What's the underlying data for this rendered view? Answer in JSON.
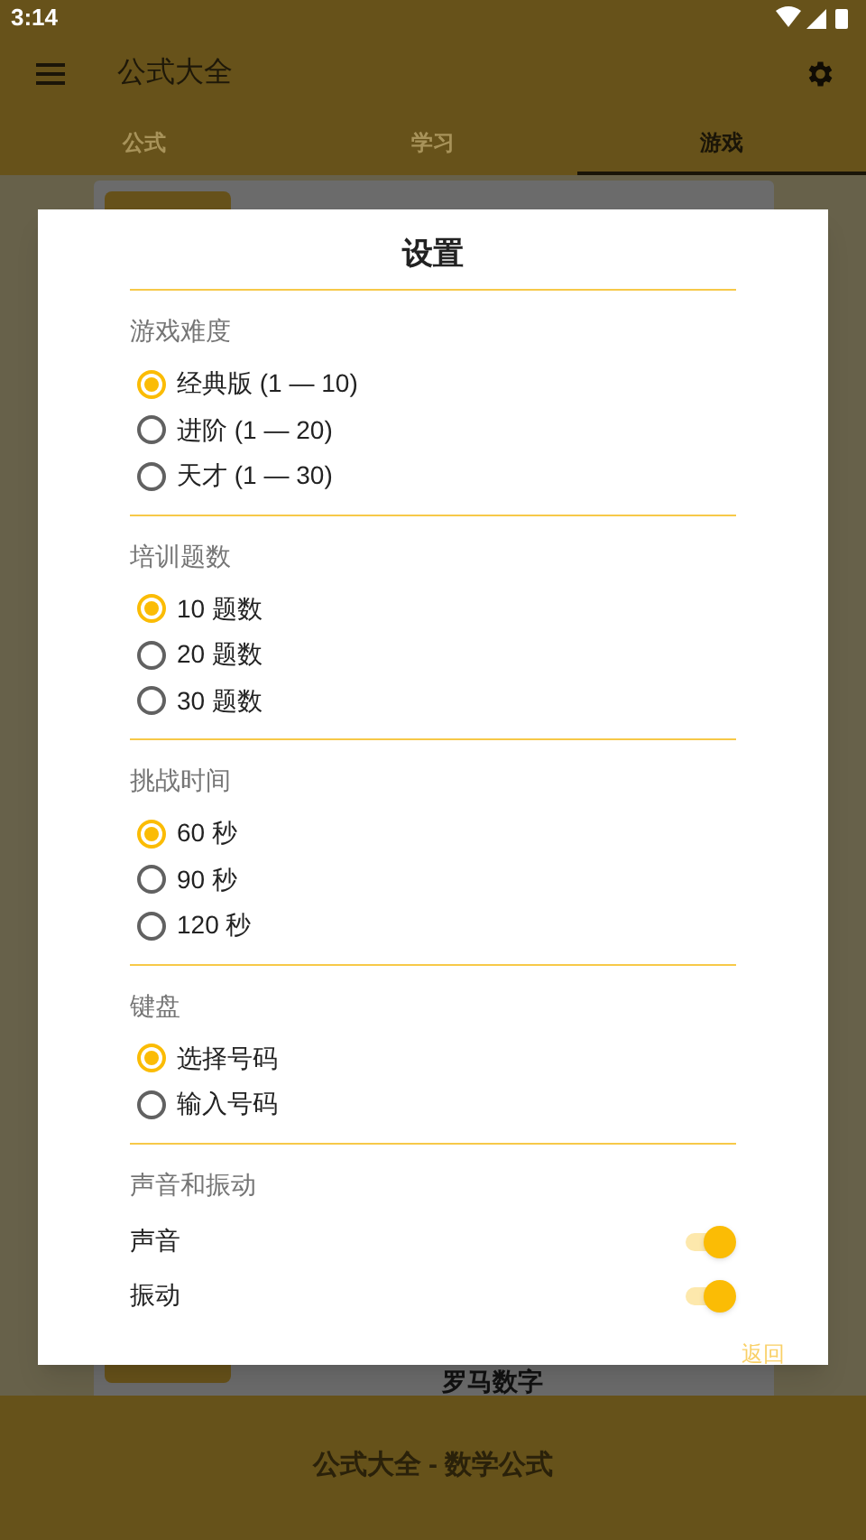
{
  "status_bar": {
    "time": "3:14"
  },
  "app_bar": {
    "title": "公式大全"
  },
  "tabs": [
    {
      "label": "公式",
      "selected": false
    },
    {
      "label": "学习",
      "selected": false
    },
    {
      "label": "游戏",
      "selected": true
    }
  ],
  "card": {
    "title": "罗马数字"
  },
  "footer": {
    "text": "公式大全 - 数学公式"
  },
  "dialog": {
    "title": "设置",
    "sections": [
      {
        "header": "游戏难度",
        "kind": "radio",
        "options": [
          {
            "label": "经典版 (1 — 10)",
            "selected": true
          },
          {
            "label": "进阶 (1 — 20)",
            "selected": false
          },
          {
            "label": "天才 (1 — 30)",
            "selected": false
          }
        ]
      },
      {
        "header": "培训题数",
        "kind": "radio",
        "options": [
          {
            "label": "10 题数",
            "selected": true
          },
          {
            "label": "20 题数",
            "selected": false
          },
          {
            "label": "30 题数",
            "selected": false
          }
        ]
      },
      {
        "header": "挑战时间",
        "kind": "radio",
        "options": [
          {
            "label": "60 秒",
            "selected": true
          },
          {
            "label": "90 秒",
            "selected": false
          },
          {
            "label": "120 秒",
            "selected": false
          }
        ]
      },
      {
        "header": "键盘",
        "kind": "radio",
        "options": [
          {
            "label": "选择号码",
            "selected": true
          },
          {
            "label": "输入号码",
            "selected": false
          }
        ]
      },
      {
        "header": "声音和振动",
        "kind": "switch",
        "options": [
          {
            "label": "声音",
            "on": true
          },
          {
            "label": "振动",
            "on": true
          }
        ]
      }
    ],
    "button": "返回"
  }
}
